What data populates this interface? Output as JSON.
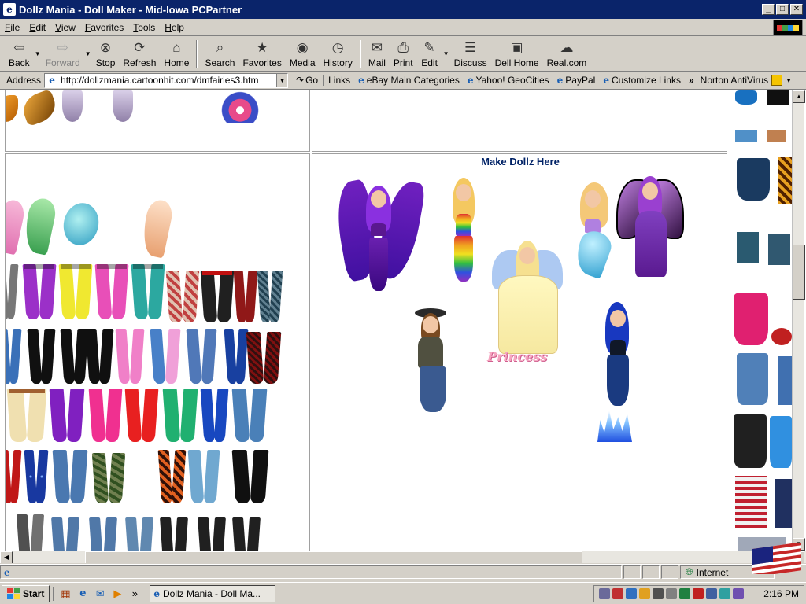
{
  "window": {
    "title": "Dollz Mania - Doll Maker - Mid-Iowa PCPartner",
    "icon_letter": "e",
    "minimize": "_",
    "maximize": "□",
    "close": "✕"
  },
  "menu": [
    "File",
    "Edit",
    "View",
    "Favorites",
    "Tools",
    "Help"
  ],
  "toolbar": {
    "back": "Back",
    "forward": "Forward",
    "stop": "Stop",
    "refresh": "Refresh",
    "home": "Home",
    "search": "Search",
    "favorites": "Favorites",
    "media": "Media",
    "history": "History",
    "mail": "Mail",
    "print": "Print",
    "edit": "Edit",
    "discuss": "Discuss",
    "dell_home": "Dell Home",
    "realcom": "Real.com"
  },
  "address": {
    "label": "Address",
    "url": "http://dollzmania.cartoonhit.com/dmfairies3.htm",
    "go": "Go",
    "links_label": "Links",
    "links": [
      "eBay Main Categories",
      "Yahoo! GeoCities",
      "PayPal",
      "Customize Links"
    ],
    "more": "»",
    "norton": "Norton AntiVirus"
  },
  "page": {
    "heading": "Make Dollz Here",
    "princess_text": "Princess"
  },
  "status": {
    "zone": "Internet"
  },
  "taskbar": {
    "start": "Start",
    "task": "Dollz Mania - Doll Ma...",
    "clock": "2:16 PM",
    "more": "»"
  },
  "colors": {
    "titlebar": "#0a246a",
    "chrome": "#d4d0c8",
    "heading": "#002266"
  }
}
